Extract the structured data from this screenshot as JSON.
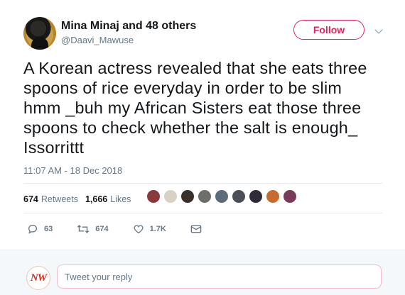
{
  "header": {
    "name": "Mina Minaj and 48 others",
    "handle": "@Daavi_Mawuse",
    "follow_label": "Follow"
  },
  "tweet": {
    "lines": [
      "A Korean actress revealed that she eats three",
      "spoons of rice everyday in order to be slim",
      "hmm _buh my African Sisters  eat those three",
      "spoons to check whether  the salt is enough_",
      "Issorrittt"
    ],
    "timestamp": "11:07 AM - 18 Dec 2018"
  },
  "stats": {
    "retweets_count": "674",
    "retweets_label": "Retweets",
    "likes_count": "1,666",
    "likes_label": "Likes",
    "liker_colors": [
      "#8a3a3a",
      "#d9d2c4",
      "#3b2f2a",
      "#6d6f6a",
      "#5d6b7a",
      "#4a4f58",
      "#2e2a3a",
      "#c96a2e",
      "#7a3a5a"
    ]
  },
  "actions": {
    "reply_count": "63",
    "retweet_count": "674",
    "like_count": "1.7K"
  },
  "reply_box": {
    "avatar_text": "NW",
    "placeholder": "Tweet your reply"
  },
  "colors": {
    "accent_pink": "#e0245e",
    "muted": "#657786",
    "divider": "#e6ecf0"
  }
}
